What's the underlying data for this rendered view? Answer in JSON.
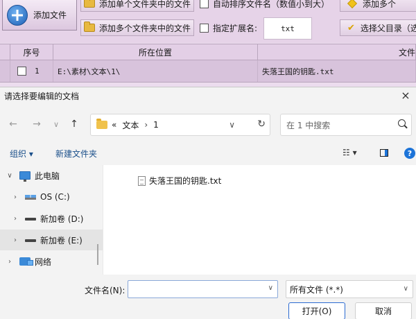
{
  "app": {
    "toolbar": {
      "add_file": "添加文件",
      "add_single_folder": "添加单个文件夹中的文件",
      "add_multi_folder": "添加多个文件夹中的文件",
      "auto_sort": "自动排序文件名（数值小到大）",
      "ext_label": "指定扩展名:",
      "ext_value": "txt",
      "add_more_partial": "添加多个",
      "select_parent_partial": "选择父目录（选"
    },
    "grid": {
      "headers": [
        "序号",
        "所在位置",
        "文件"
      ],
      "rows": [
        {
          "index": "1",
          "location": "E:\\素材\\文本\\1\\",
          "filename": "失落王国的钥匙.txt"
        }
      ]
    }
  },
  "dialog": {
    "title": "请选择要编辑的文档",
    "close": "×",
    "nav": {
      "back": "←",
      "forward": "→",
      "recent": "∨",
      "up": "↑"
    },
    "address": {
      "overflow": "«",
      "parts": [
        "文本",
        "1"
      ],
      "separator": "›",
      "dropdown": "∨",
      "refresh": "↻"
    },
    "search": {
      "placeholder": "在 1 中搜索"
    },
    "commands": {
      "organize": "组织 ▾",
      "new_folder": "新建文件夹",
      "view": "☷ ▾",
      "help": "?"
    },
    "tree": [
      {
        "label": "此电脑",
        "expander": "∨",
        "icon": "computer-icon"
      },
      {
        "label": "OS (C:)",
        "expander": "›",
        "icon": "os-drive-icon"
      },
      {
        "label": "新加卷 (D:)",
        "expander": "›",
        "icon": "drive-icon"
      },
      {
        "label": "新加卷 (E:)",
        "expander": "›",
        "icon": "drive-icon"
      },
      {
        "label": "网络",
        "expander": "›",
        "icon": "network-icon"
      }
    ],
    "files": [
      {
        "name": "失落王国的钥匙.txt",
        "icon": "text-file-icon"
      }
    ],
    "bottom": {
      "filename_label": "文件名(N):",
      "filename_value": "",
      "filetype": "所有文件 (*.*)",
      "open": "打开(O)",
      "cancel": "取消"
    }
  }
}
